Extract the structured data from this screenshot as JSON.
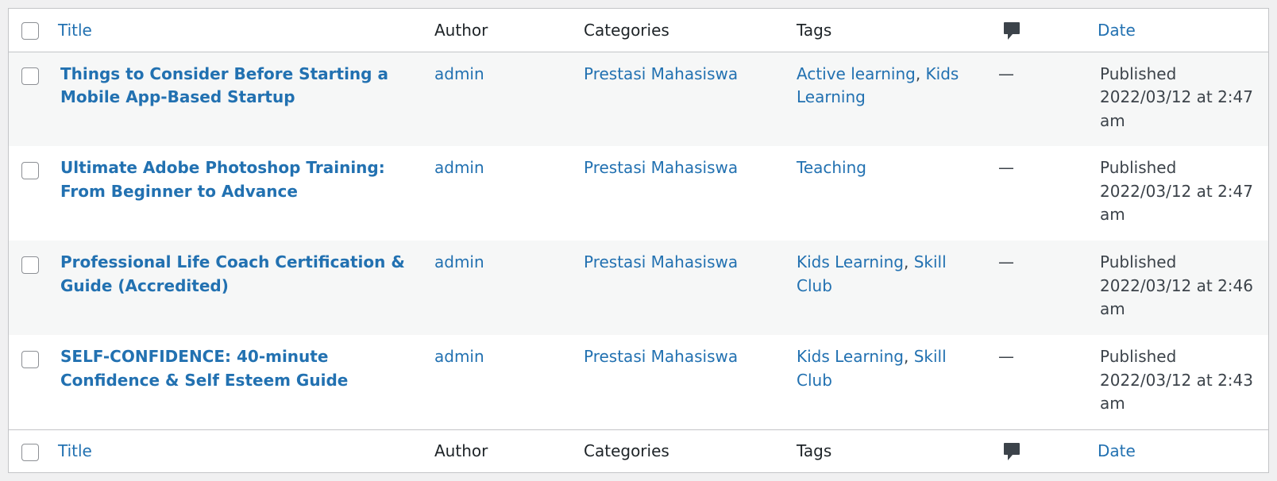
{
  "header": {
    "title_label": "Title",
    "author_label": "Author",
    "categories_label": "Categories",
    "tags_label": "Tags",
    "comments_icon": "comment-bubble-icon",
    "date_label": "Date"
  },
  "footer": {
    "title_label": "Title",
    "author_label": "Author",
    "categories_label": "Categories",
    "tags_label": "Tags",
    "comments_icon": "comment-bubble-icon",
    "date_label": "Date"
  },
  "posts": [
    {
      "title": "Things to Consider Before Starting a Mobile App-Based Startup",
      "author": "admin",
      "category": "Prestasi Mahasiswa",
      "tags": [
        "Active learning",
        "Kids Learning"
      ],
      "comments": "—",
      "status": "Published",
      "date": "2022/03/12 at 2:47 am"
    },
    {
      "title": "Ultimate Adobe Photoshop Training: From Beginner to Advance",
      "author": "admin",
      "category": "Prestasi Mahasiswa",
      "tags": [
        "Teaching"
      ],
      "comments": "—",
      "status": "Published",
      "date": "2022/03/12 at 2:47 am"
    },
    {
      "title": "Professional Life Coach Certification & Guide (Accredited)",
      "author": "admin",
      "category": "Prestasi Mahasiswa",
      "tags": [
        "Kids Learning",
        "Skill Club"
      ],
      "comments": "—",
      "status": "Published",
      "date": "2022/03/12 at 2:46 am"
    },
    {
      "title": "SELF-CONFIDENCE: 40-minute Confidence & Self Esteem Guide",
      "author": "admin",
      "category": "Prestasi Mahasiswa",
      "tags": [
        "Kids Learning",
        "Skill Club"
      ],
      "comments": "—",
      "status": "Published",
      "date": "2022/03/12 at 2:43 am"
    }
  ],
  "colors": {
    "link": "#2271b1",
    "text": "#3c434a",
    "alt_row": "#f6f7f7",
    "border": "#c3c4c7"
  }
}
